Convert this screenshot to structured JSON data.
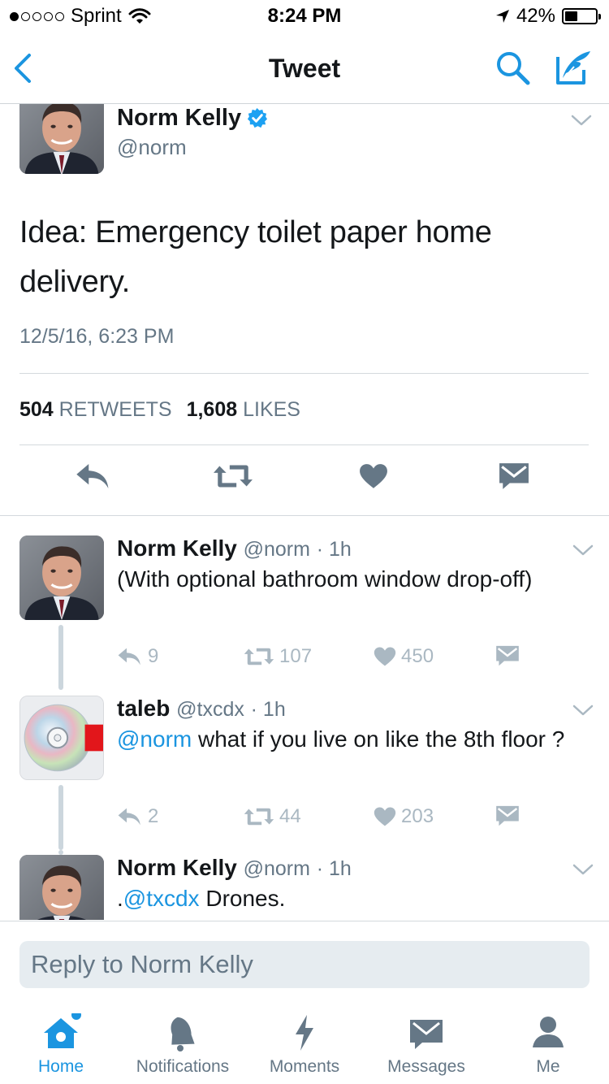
{
  "status": {
    "carrier": "Sprint",
    "time": "8:24 PM",
    "battery": "42%",
    "battery_level": 0.42,
    "signal_bars": 1
  },
  "nav": {
    "title": "Tweet"
  },
  "main_tweet": {
    "name": "Norm Kelly",
    "handle": "@norm",
    "text": "Idea: Emergency toilet paper home delivery.",
    "timestamp": "12/5/16, 6:23 PM",
    "retweets_count": "504",
    "retweets_label": "RETWEETS",
    "likes_count": "1,608",
    "likes_label": "LIKES"
  },
  "replies": [
    {
      "name": "Norm Kelly",
      "handle": "@norm",
      "time": "· 1h",
      "text": "(With optional bathroom window drop-off)",
      "reply_count": "9",
      "retweet_count": "107",
      "like_count": "450"
    },
    {
      "name": "taleb",
      "handle": "@txcdx",
      "time": "· 1h",
      "mention": "@norm",
      "text": " what if you live on like the 8th floor ?",
      "reply_count": "2",
      "retweet_count": "44",
      "like_count": "203"
    },
    {
      "name": "Norm Kelly",
      "handle": "@norm",
      "time": "· 1h",
      "prefix": ".",
      "mention": "@txcdx",
      "text": " Drones."
    }
  ],
  "reply_bar": {
    "placeholder": "Reply to Norm Kelly"
  },
  "tabs": [
    {
      "label": "Home",
      "icon": "home-icon",
      "active": true
    },
    {
      "label": "Notifications",
      "icon": "bell-icon"
    },
    {
      "label": "Moments",
      "icon": "lightning-icon"
    },
    {
      "label": "Messages",
      "icon": "envelope-icon"
    },
    {
      "label": "Me",
      "icon": "person-icon"
    }
  ],
  "colors": {
    "accent": "#1b95e0",
    "secondary_text": "#657786",
    "action_icon": "#657786",
    "muted_icon": "#aab8c2",
    "verified": "#1da1f2"
  }
}
